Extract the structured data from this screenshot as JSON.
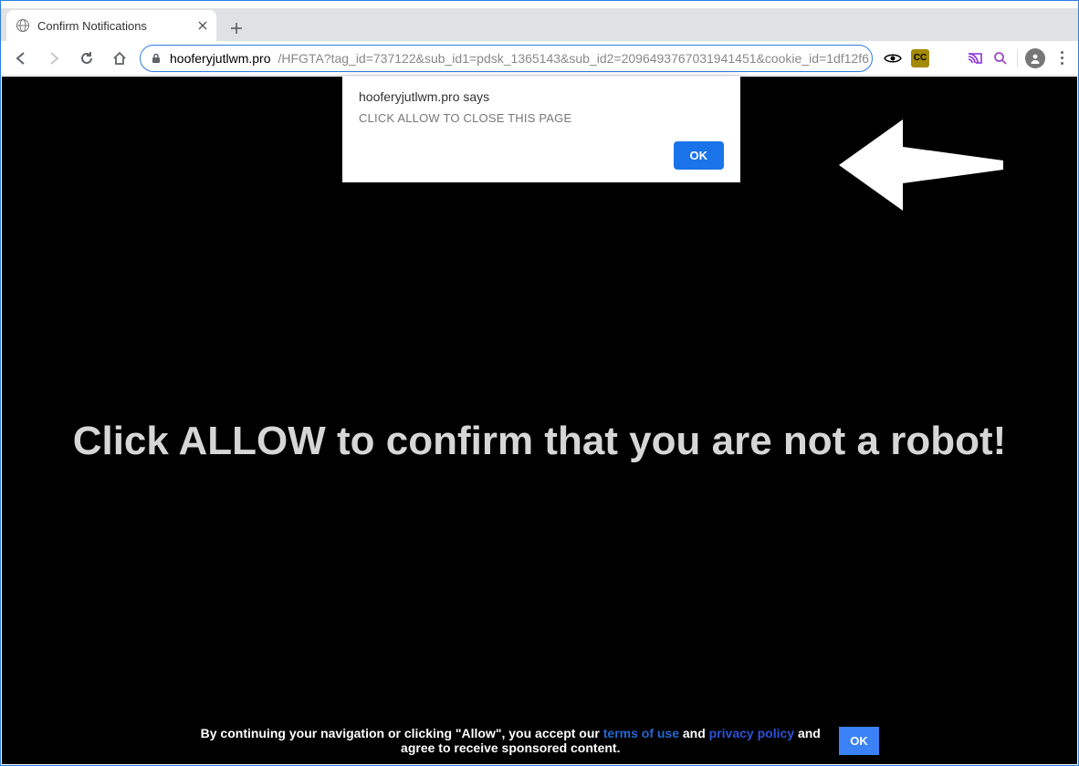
{
  "window": {
    "tab_title": "Confirm Notifications"
  },
  "addressbar": {
    "domain": "hooferyjutlwm.pro",
    "path": "/HFGTA?tag_id=737122&sub_id1=pdsk_1365143&sub_id2=2096493767031941451&cookie_id=1df12f6"
  },
  "extensions": {
    "cc_label": "CC"
  },
  "alert": {
    "host_line": "hooferyjutlwm.pro says",
    "message": "CLICK ALLOW TO CLOSE THIS PAGE",
    "ok_label": "OK"
  },
  "page": {
    "headline": "Click ALLOW to confirm that you are not a robot!",
    "footer_pre": "By continuing your navigation or clicking \"Allow\", you accept our ",
    "terms_label": "terms of use",
    "footer_mid": " and ",
    "privacy_label": "privacy policy",
    "footer_post": " and agree to receive sponsored content.",
    "footer_ok_label": "OK"
  }
}
